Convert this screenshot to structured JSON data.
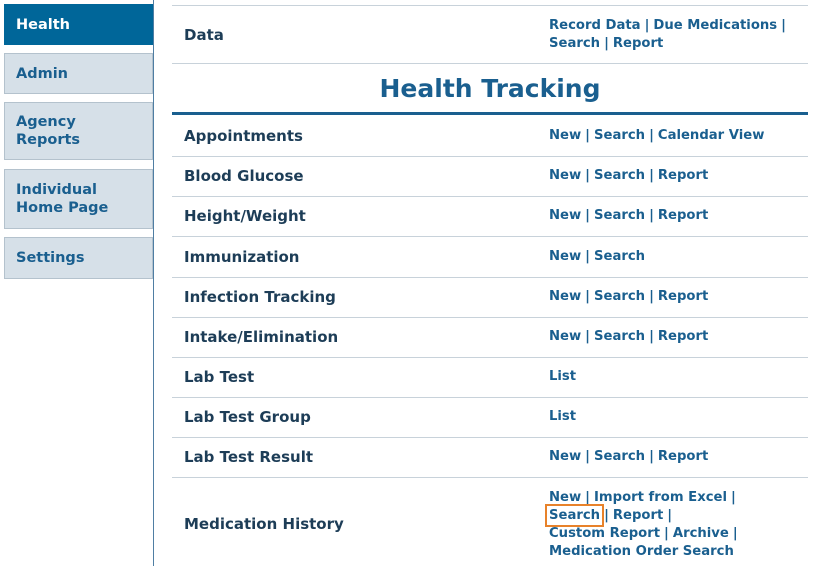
{
  "sidebar": {
    "items": [
      {
        "label": "Health",
        "active": true
      },
      {
        "label": "Admin"
      },
      {
        "label": "Agency Reports"
      },
      {
        "label": "Individual Home Page"
      },
      {
        "label": "Settings"
      }
    ]
  },
  "data_row": {
    "label": "Data",
    "links": [
      "Record Data",
      "Due Medications",
      "Search",
      "Report"
    ]
  },
  "section_title": "Health Tracking",
  "rows": [
    {
      "label": "Appointments",
      "links": [
        "New",
        "Search",
        "Calendar View"
      ]
    },
    {
      "label": "Blood Glucose",
      "links": [
        "New",
        "Search",
        "Report"
      ]
    },
    {
      "label": "Height/Weight",
      "links": [
        "New",
        "Search",
        "Report"
      ]
    },
    {
      "label": "Immunization",
      "links": [
        "New",
        "Search"
      ]
    },
    {
      "label": "Infection Tracking",
      "links": [
        "New",
        "Search",
        "Report"
      ]
    },
    {
      "label": "Intake/Elimination",
      "links": [
        "New",
        "Search",
        "Report"
      ]
    },
    {
      "label": "Lab Test",
      "links": [
        "List"
      ]
    },
    {
      "label": "Lab Test Group",
      "links": [
        "List"
      ]
    },
    {
      "label": "Lab Test Result",
      "links": [
        "New",
        "Search",
        "Report"
      ]
    },
    {
      "label": "Medication History",
      "links": [
        "New",
        "Import from Excel",
        "Search",
        "Report",
        "Custom Report",
        "Archive",
        "Medication Order Search"
      ],
      "highlighted": "Search"
    }
  ],
  "colors": {
    "accent": "#006699",
    "link": "#1a5f8f",
    "highlight": "#e8822a"
  }
}
